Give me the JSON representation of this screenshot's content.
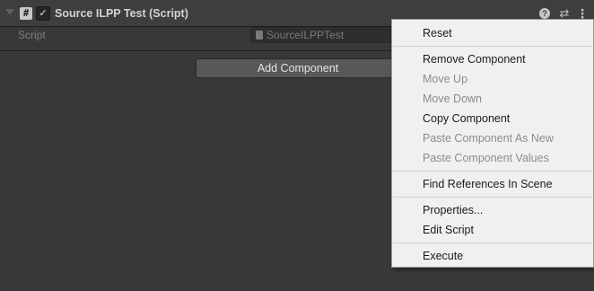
{
  "component": {
    "title": "Source ILPP Test (Script)",
    "script_icon_glyph": "#",
    "enabled_glyph": "✓",
    "help_glyph": "?",
    "presets_glyph": "⇄",
    "more_glyph": "⋮",
    "enabled": true
  },
  "script_row": {
    "label": "Script",
    "value": "SourceILPPTest"
  },
  "add_component_label": "Add Component",
  "context_menu": {
    "items": [
      {
        "label": "Reset",
        "enabled": true
      },
      {
        "label": "Remove Component",
        "enabled": true
      },
      {
        "label": "Move Up",
        "enabled": false
      },
      {
        "label": "Move Down",
        "enabled": false
      },
      {
        "label": "Copy Component",
        "enabled": true
      },
      {
        "label": "Paste Component As New",
        "enabled": false
      },
      {
        "label": "Paste Component Values",
        "enabled": false
      },
      {
        "label": "Find References In Scene",
        "enabled": true
      },
      {
        "label": "Properties...",
        "enabled": true
      },
      {
        "label": "Edit Script",
        "enabled": true
      },
      {
        "label": "Execute",
        "enabled": true
      }
    ]
  },
  "colors": {
    "panel_bg": "#383838",
    "menu_bg": "#f0f0f0",
    "menu_text": "#1a1a1a",
    "menu_text_disabled": "#8c8c8c"
  },
  "icons": {
    "foldout": "triangle-down-icon",
    "script": "csharp-script-icon",
    "help": "help-icon",
    "presets": "presets-icon",
    "more": "more-vertical-icon"
  }
}
